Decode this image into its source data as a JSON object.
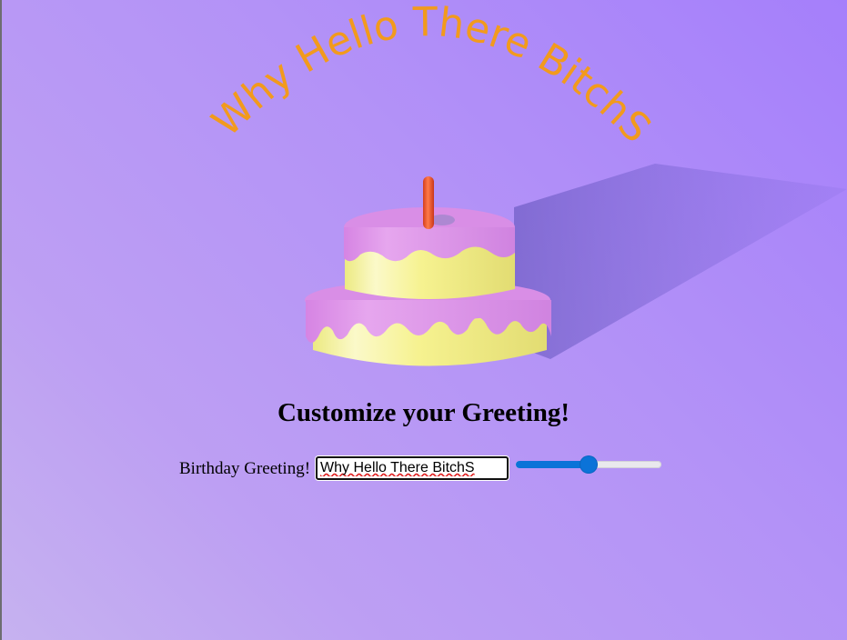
{
  "greeting": {
    "arc_text": "Why Hello There BitchS"
  },
  "heading": {
    "title": "Customize your Greeting!"
  },
  "form": {
    "label": "Birthday Greeting!",
    "input_value": "Why Hello There BitchS",
    "slider_value_fraction": 0.5
  },
  "colors": {
    "greeting_text": "#f29a1d",
    "frosting": "#d98ee6",
    "cake_body": "#f4f08a",
    "candle": "#f0552e",
    "slider_accent": "#0b73d8"
  }
}
